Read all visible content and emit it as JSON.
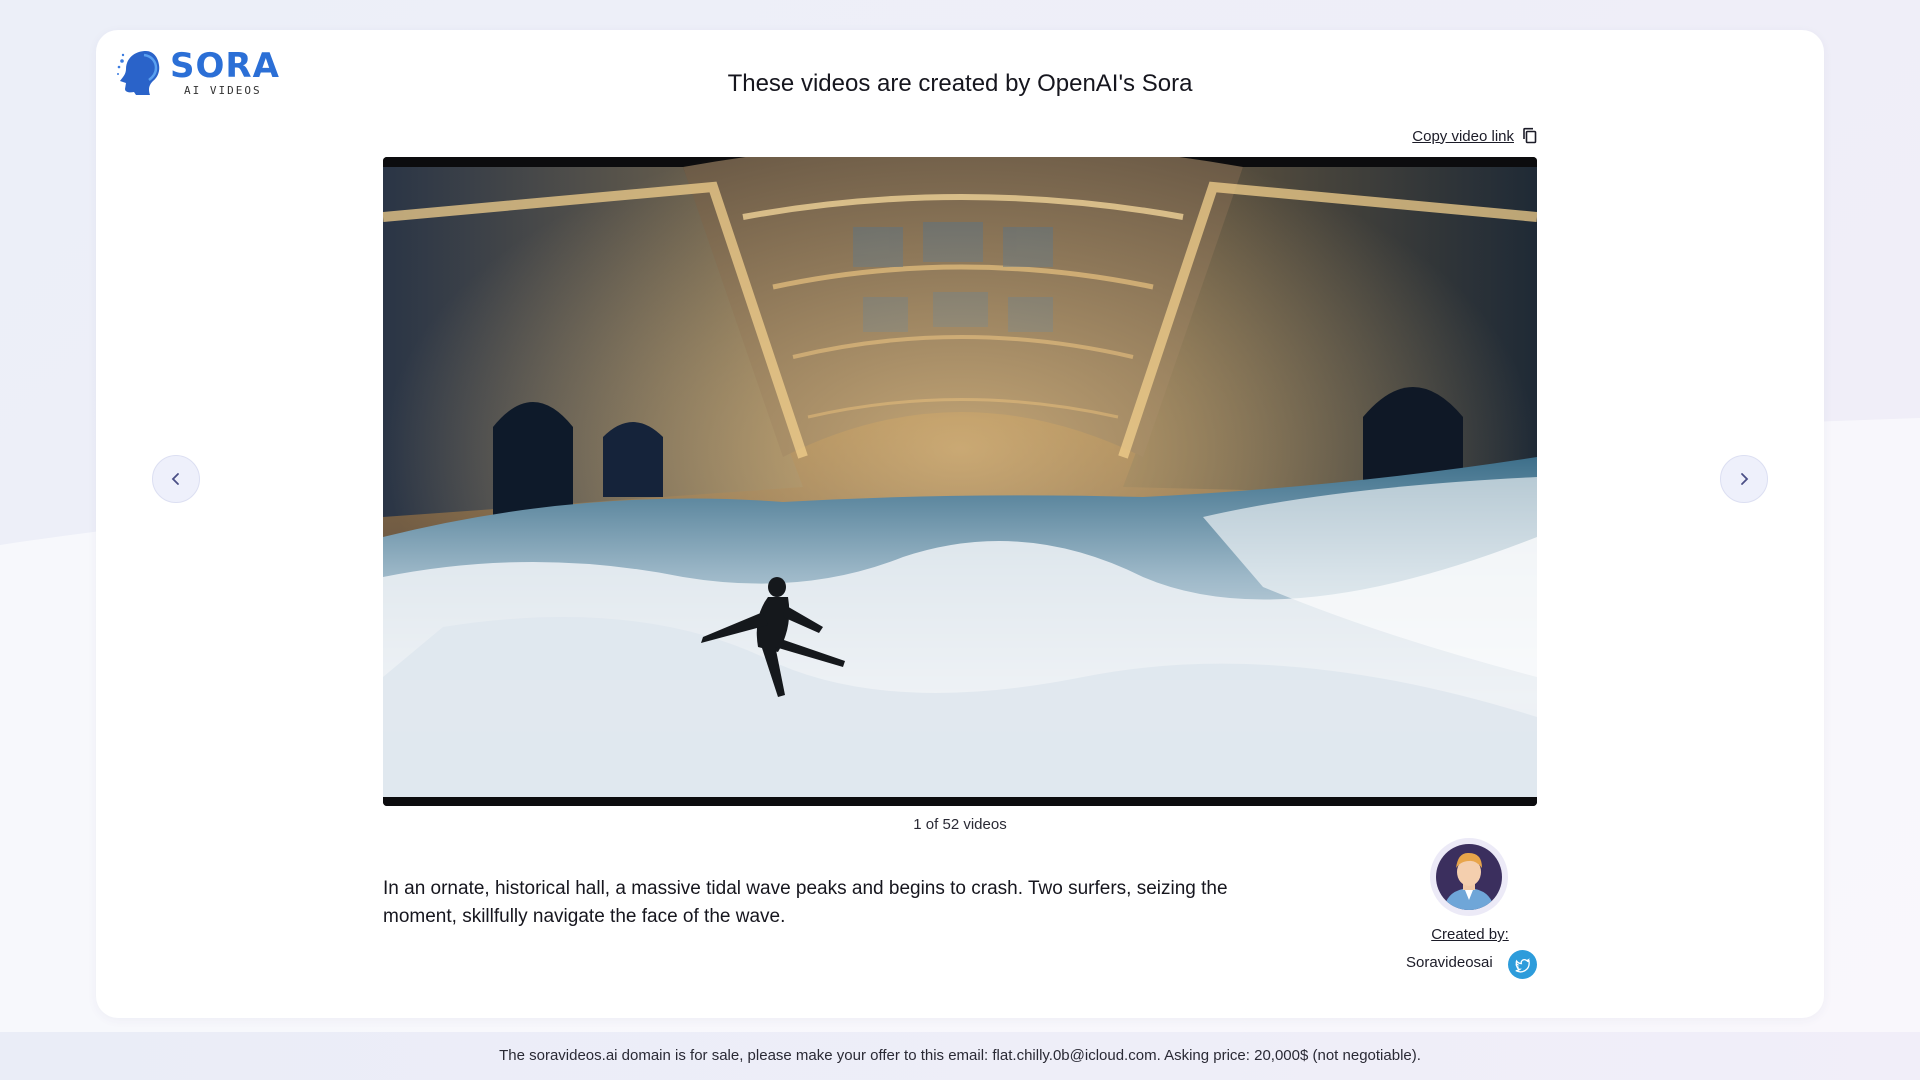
{
  "brand": {
    "name": "SORA",
    "tagline": "AI VIDEOS"
  },
  "header": {
    "title": "These videos are created by OpenAI's Sora"
  },
  "toolbar": {
    "copy_link_label": "Copy video link",
    "copy_icon": "copy-icon"
  },
  "video": {
    "counter": "1 of 52 videos",
    "description": "In an ornate, historical hall, a massive tidal wave peaks and begins to crash. Two surfers, seizing the moment, skillfully navigate the face of the wave."
  },
  "navigation": {
    "prev_icon": "chevron-left-icon",
    "next_icon": "chevron-right-icon"
  },
  "creator": {
    "label": "Created by:",
    "name": "Soravideosai",
    "social_icon": "twitter-icon"
  },
  "footer": {
    "text": "The soravideos.ai domain is for sale, please make your offer to this email: flat.chilly.0b@icloud.com. Asking price: 20,000$ (not negotiable)."
  },
  "colors": {
    "brand_blue": "#2b6fd6",
    "twitter_blue": "#2d9cdb",
    "nav_button_bg": "#eef0fb",
    "card_bg": "#ffffff"
  }
}
